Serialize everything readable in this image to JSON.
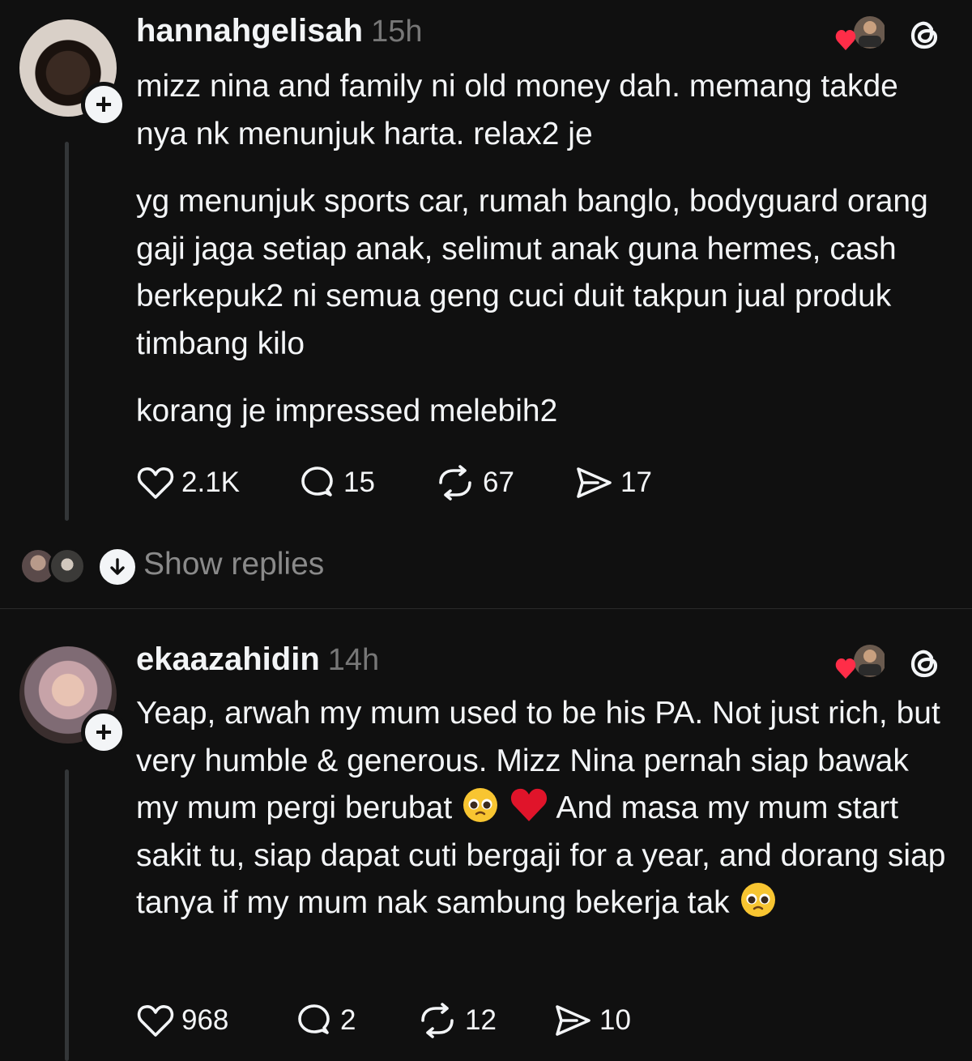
{
  "posts": [
    {
      "username": "hannahgelisah",
      "time": "15h",
      "paragraphs": [
        "mizz nina and family ni old money dah. memang takde nya nk menunjuk harta. relax2 je",
        "yg menunjuk sports car, rumah banglo, bodyguard orang gaji jaga setiap anak, selimut anak guna hermes, cash berkepuk2 ni semua geng cuci duit takpun jual produk timbang kilo",
        "korang je impressed melebih2"
      ],
      "likes": "2.1K",
      "replies": "15",
      "reposts": "67",
      "shares": "17",
      "show_replies": "Show replies"
    },
    {
      "username": "ekaazahidin",
      "time": "14h",
      "text_part1": "Yeap, arwah my mum used to be his PA. Not just rich, but very humble & generous. Mizz Nina pernah siap bawak my mum pergi berubat",
      "text_part2": "And masa my mum start sakit tu, siap dapat cuti bergaji for a year, and dorang siap tanya if my mum nak sambung bekerja tak",
      "likes": "968",
      "replies": "2",
      "reposts": "12",
      "shares": "10"
    }
  ],
  "icons": {
    "follow": "+",
    "like": "heart-icon",
    "reply": "comment-icon",
    "repost": "repost-icon",
    "share": "send-icon",
    "liked_by": "heart-avatar-reaction",
    "app_logo": "threads-logo",
    "expand": "arrow-down-icon",
    "emoji_pleading": "pleading-face-emoji",
    "emoji_heart": "red-heart-emoji"
  }
}
